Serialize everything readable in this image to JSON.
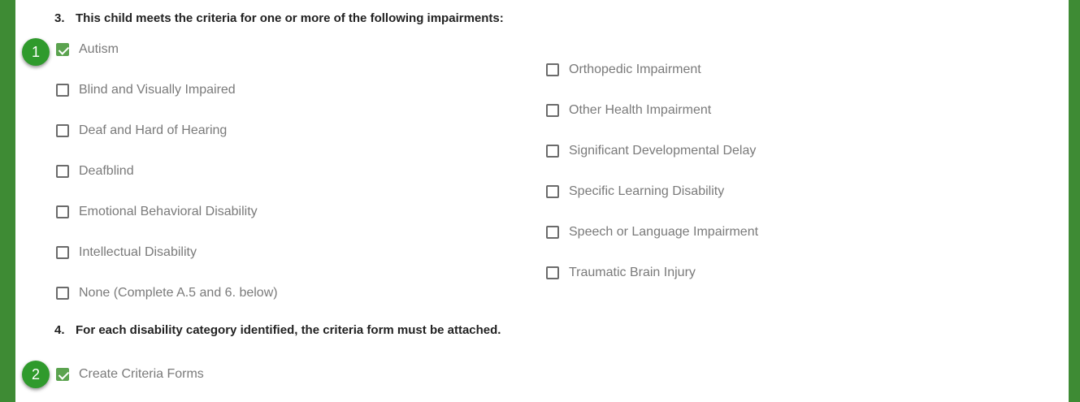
{
  "question3": {
    "number": "3.",
    "text": "This child meets the criteria for one or more of the following impairments:"
  },
  "impairments_left": [
    {
      "label": "Autism",
      "checked": true
    },
    {
      "label": "Blind and Visually Impaired",
      "checked": false
    },
    {
      "label": "Deaf and Hard of Hearing",
      "checked": false
    },
    {
      "label": "Deafblind",
      "checked": false
    },
    {
      "label": "Emotional Behavioral Disability",
      "checked": false
    },
    {
      "label": "Intellectual Disability",
      "checked": false
    },
    {
      "label": "None (Complete A.5 and 6. below)",
      "checked": false
    }
  ],
  "impairments_right": [
    {
      "label": "Orthopedic Impairment",
      "checked": false
    },
    {
      "label": "Other Health Impairment",
      "checked": false
    },
    {
      "label": "Significant Developmental Delay",
      "checked": false
    },
    {
      "label": "Specific Learning Disability",
      "checked": false
    },
    {
      "label": "Speech or Language Impairment",
      "checked": false
    },
    {
      "label": "Traumatic Brain Injury",
      "checked": false
    }
  ],
  "question4": {
    "number": "4.",
    "text": "For each disability category identified, the criteria form must be attached."
  },
  "criteria_forms": {
    "label": "Create Criteria Forms",
    "checked": true
  },
  "markers": [
    "1",
    "2"
  ],
  "colors": {
    "frame_green": "#3e8b34",
    "checkbox_checked": "#5ba34f",
    "marker_green": "#2f9a2c",
    "label_gray": "#7a7a7a"
  }
}
